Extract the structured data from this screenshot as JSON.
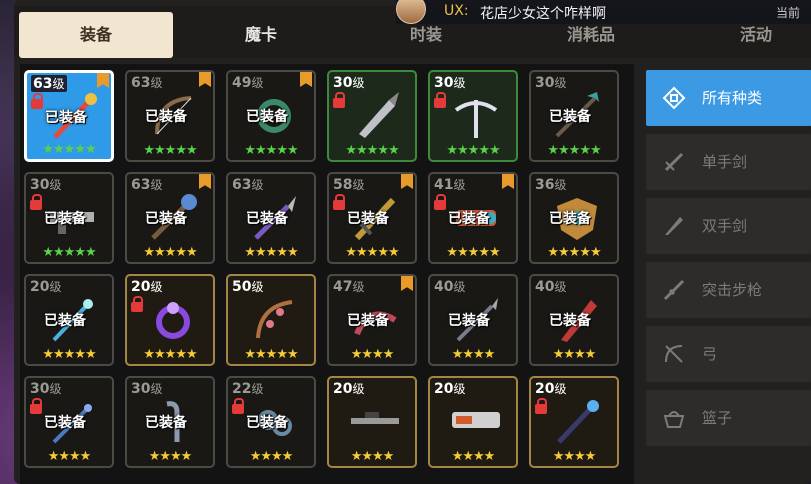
{
  "tabs": [
    {
      "label": "装备"
    },
    {
      "label": "魔卡"
    },
    {
      "label": "时装"
    },
    {
      "label": "消耗品"
    },
    {
      "label": "活动"
    }
  ],
  "chat": {
    "name": "UX:",
    "message": "花店少女这个咋样啊",
    "now": "当前"
  },
  "level_unit": "级",
  "equipped_label": "已装备",
  "items": [
    {
      "level": "63",
      "equipped": true,
      "locked": true,
      "stars": "★★★★★",
      "star_color": "green",
      "frame": "sel",
      "badge": true,
      "weapon": "staff",
      "color": "#e84a3a"
    },
    {
      "level": "63",
      "equipped": true,
      "locked": false,
      "stars": "★★★★★",
      "star_color": "green",
      "frame": "gray",
      "badge": true,
      "weapon": "bow",
      "color": "#8a6a4a"
    },
    {
      "level": "49",
      "equipped": true,
      "locked": false,
      "stars": "★★★★★",
      "star_color": "green",
      "frame": "gray",
      "badge": true,
      "weapon": "wreath",
      "color": "#3a8a6a"
    },
    {
      "level": "30",
      "equipped": false,
      "locked": true,
      "stars": "★★★★★",
      "star_color": "green",
      "frame": "green",
      "badge": false,
      "weapon": "drill",
      "color": "#c0c0c8"
    },
    {
      "level": "30",
      "equipped": false,
      "locked": true,
      "stars": "★★★★★",
      "star_color": "green",
      "frame": "green",
      "badge": false,
      "weapon": "crossbow",
      "color": "#e0e0f0"
    },
    {
      "level": "30",
      "equipped": true,
      "locked": false,
      "stars": "★★★★★",
      "star_color": "green",
      "frame": "gray",
      "badge": false,
      "weapon": "spear",
      "color": "#3aa0a0"
    },
    {
      "level": "30",
      "equipped": true,
      "locked": true,
      "stars": "★★★★★",
      "star_color": "green",
      "frame": "gray",
      "badge": false,
      "weapon": "rifle",
      "color": "#b0b0b0"
    },
    {
      "level": "63",
      "equipped": true,
      "locked": false,
      "stars": "★★★★★",
      "star_color": "gold",
      "frame": "gray",
      "badge": true,
      "weapon": "orbstaff",
      "color": "#5a8ad0"
    },
    {
      "level": "63",
      "equipped": true,
      "locked": false,
      "stars": "★★★★★",
      "star_color": "gold",
      "frame": "gray",
      "badge": false,
      "weapon": "scepter",
      "color": "#7a5ac0"
    },
    {
      "level": "58",
      "equipped": true,
      "locked": true,
      "stars": "★★★★★",
      "star_color": "gold",
      "frame": "gray",
      "badge": true,
      "weapon": "sword",
      "color": "#c09a3a"
    },
    {
      "level": "41",
      "equipped": true,
      "locked": true,
      "stars": "★★★★★",
      "star_color": "gold",
      "frame": "gray",
      "badge": true,
      "weapon": "cannon",
      "color": "#d05a3a"
    },
    {
      "level": "36",
      "equipped": true,
      "locked": false,
      "stars": "★★★★★",
      "star_color": "gold",
      "frame": "gray",
      "badge": false,
      "weapon": "shield",
      "color": "#c08a3a"
    },
    {
      "level": "20",
      "equipped": true,
      "locked": false,
      "stars": "★★★★★",
      "star_color": "gold",
      "frame": "gray",
      "badge": false,
      "weapon": "frost",
      "color": "#4ab0e0"
    },
    {
      "level": "20",
      "equipped": false,
      "locked": true,
      "stars": "★★★★★",
      "star_color": "gold",
      "frame": "gold",
      "badge": false,
      "weapon": "ring",
      "color": "#8a4ae0"
    },
    {
      "level": "50",
      "equipped": false,
      "locked": false,
      "stars": "★★★★★",
      "star_color": "gold",
      "frame": "gold",
      "badge": false,
      "weapon": "flowerbow",
      "color": "#e07a8a"
    },
    {
      "level": "47",
      "equipped": true,
      "locked": false,
      "stars": "★★★★",
      "star_color": "gold",
      "frame": "gray",
      "badge": true,
      "weapon": "whip",
      "color": "#c04a5a"
    },
    {
      "level": "40",
      "equipped": true,
      "locked": false,
      "stars": "★★★★",
      "star_color": "gold",
      "frame": "gray",
      "badge": false,
      "weapon": "trident",
      "color": "#7a7a90"
    },
    {
      "level": "40",
      "equipped": true,
      "locked": false,
      "stars": "★★★★",
      "star_color": "gold",
      "frame": "gray",
      "badge": false,
      "weapon": "blade",
      "color": "#c03a3a"
    },
    {
      "level": "30",
      "equipped": true,
      "locked": true,
      "stars": "★★★★",
      "star_color": "gold",
      "frame": "gray",
      "badge": false,
      "weapon": "wand",
      "color": "#4a7ac0"
    },
    {
      "level": "30",
      "equipped": true,
      "locked": false,
      "stars": "★★★★",
      "star_color": "gold",
      "frame": "gray",
      "badge": false,
      "weapon": "hook",
      "color": "#8a9ab0"
    },
    {
      "level": "22",
      "equipped": true,
      "locked": true,
      "stars": "★★★★",
      "star_color": "gold",
      "frame": "gray",
      "badge": false,
      "weapon": "chain",
      "color": "#6a8aa0"
    },
    {
      "level": "20",
      "equipped": false,
      "locked": false,
      "stars": "★★★★",
      "star_color": "gold",
      "frame": "gold",
      "badge": false,
      "weapon": "sniper",
      "color": "#9a9a9a"
    },
    {
      "level": "20",
      "equipped": false,
      "locked": false,
      "stars": "★★★★",
      "star_color": "gold",
      "frame": "gold",
      "badge": false,
      "weapon": "gatling",
      "color": "#d0d0d0"
    },
    {
      "level": "20",
      "equipped": false,
      "locked": true,
      "stars": "★★★★",
      "star_color": "gold",
      "frame": "gold",
      "badge": false,
      "weapon": "icestaff",
      "color": "#5ab0f0"
    }
  ],
  "categories": [
    {
      "label": "所有种类",
      "icon": "all-types-icon",
      "active": true
    },
    {
      "label": "单手剑",
      "icon": "one-hand-sword-icon",
      "active": false
    },
    {
      "label": "双手剑",
      "icon": "two-hand-sword-icon",
      "active": false
    },
    {
      "label": "突击步枪",
      "icon": "assault-rifle-icon",
      "active": false
    },
    {
      "label": "弓",
      "icon": "bow-icon",
      "active": false
    },
    {
      "label": "篮子",
      "icon": "basket-icon",
      "active": false
    }
  ]
}
